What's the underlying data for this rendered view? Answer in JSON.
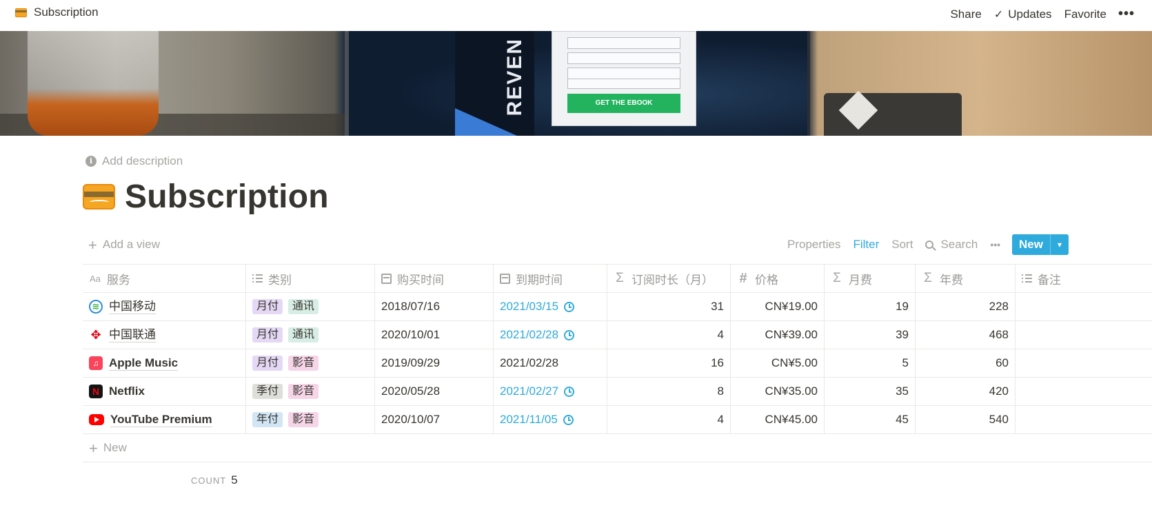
{
  "topbar": {
    "breadcrumb": "Subscription",
    "share": "Share",
    "updates": "Updates",
    "favorite": "Favorite",
    "more": "•••"
  },
  "cover": {
    "banner_word": "REVEN",
    "form_button": "GET THE EBOOK"
  },
  "page": {
    "add_description": "Add description",
    "title": "Subscription"
  },
  "viewbar": {
    "add_view": "Add a view",
    "properties": "Properties",
    "filter": "Filter",
    "sort": "Sort",
    "search": "Search",
    "more": "•••",
    "new": "New"
  },
  "table": {
    "columns": [
      "服务",
      "类别",
      "购买时间",
      "到期时间",
      "订阅时长（月）",
      "价格",
      "月费",
      "年费",
      "备注"
    ],
    "rows": [
      {
        "service": "中国移动",
        "tags": [
          "月付",
          "通讯"
        ],
        "purchase": "2018/07/16",
        "expiry": "2021/03/15",
        "duration": "31",
        "price": "CN¥19.00",
        "monthly": "19",
        "yearly": "228",
        "note": ""
      },
      {
        "service": "中国联通",
        "tags": [
          "月付",
          "通讯"
        ],
        "purchase": "2020/10/01",
        "expiry": "2021/02/28",
        "duration": "4",
        "price": "CN¥39.00",
        "monthly": "39",
        "yearly": "468",
        "note": ""
      },
      {
        "service": "Apple Music",
        "tags": [
          "月付",
          "影音"
        ],
        "purchase": "2019/09/29",
        "expiry": "2021/02/28",
        "duration": "16",
        "price": "CN¥5.00",
        "monthly": "5",
        "yearly": "60",
        "note": ""
      },
      {
        "service": "Netflix",
        "tags": [
          "季付",
          "影音"
        ],
        "purchase": "2020/05/28",
        "expiry": "2021/02/27",
        "duration": "8",
        "price": "CN¥35.00",
        "monthly": "35",
        "yearly": "420",
        "note": ""
      },
      {
        "service": "YouTube Premium",
        "tags": [
          "年付",
          "影音"
        ],
        "purchase": "2020/10/07",
        "expiry": "2021/11/05",
        "duration": "4",
        "price": "CN¥45.00",
        "monthly": "45",
        "yearly": "540",
        "note": ""
      }
    ],
    "new_row": "New",
    "count_label": "COUNT",
    "count_value": "5"
  },
  "colors": {
    "accent": "#2eaadc",
    "text": "#37352f",
    "muted": "#a6a5a1"
  }
}
